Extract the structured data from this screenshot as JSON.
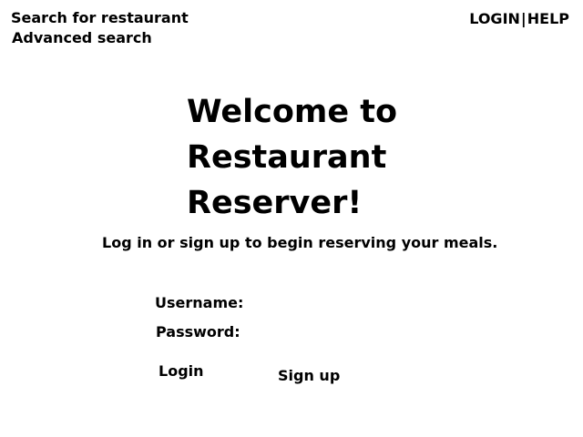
{
  "header": {
    "search_link": "Search for restaurant",
    "advanced_link": "Advanced search",
    "login_link": "LOGIN",
    "separator": "|",
    "help_link": "HELP"
  },
  "main": {
    "welcome_lines": [
      "Welcome to",
      "Restaurant",
      "Reserver!"
    ],
    "subtitle": "Log in or sign up to begin reserving your meals."
  },
  "form": {
    "username_label": "Username:",
    "password_label": "Password:",
    "login_label": "Login",
    "signup_label": "Sign up"
  }
}
